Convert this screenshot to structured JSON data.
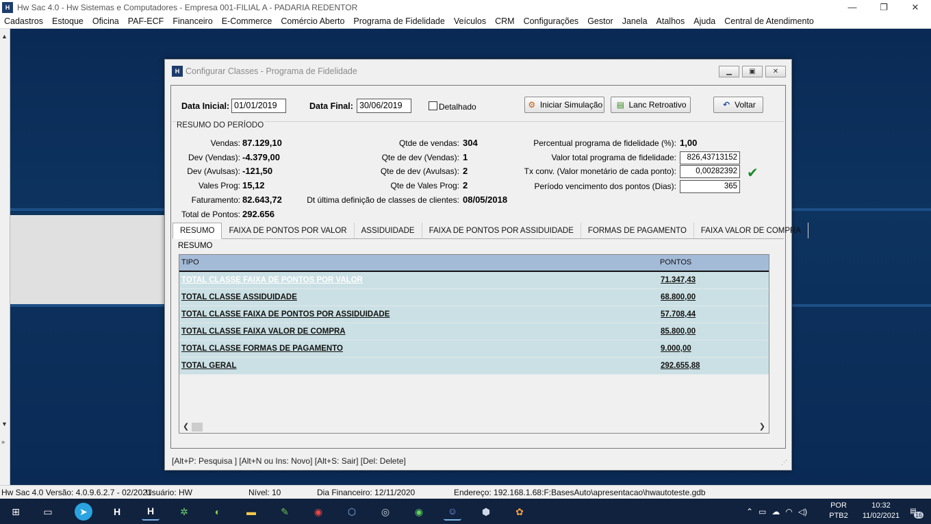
{
  "app": {
    "logo": "H",
    "title": "Hw Sac 4.0 - Hw Sistemas e Computadores - Empresa 001-FILIAL A - PADARIA REDENTOR",
    "minimize": "—",
    "restore": "❐",
    "close": "✕"
  },
  "menu": [
    "Cadastros",
    "Estoque",
    "Oficina",
    "PAF-ECF",
    "Financeiro",
    "E-Commerce",
    "Comércio Aberto",
    "Programa de Fidelidade",
    "Veículos",
    "CRM",
    "Configurações",
    "Gestor",
    "Janela",
    "Atalhos",
    "Ajuda",
    "Central de Atendimento"
  ],
  "dialog": {
    "title": "Configurar Classes - Programa de Fidelidade",
    "filters": {
      "data_inicial_label": "Data Inicial:",
      "data_inicial": "01/01/2019",
      "data_final_label": "Data Final:",
      "data_final": "30/06/2019",
      "detalhado_label": "Detalhado"
    },
    "buttons": {
      "simular": "Iniciar Simulação",
      "retroativo": "Lanc Retroativo",
      "voltar": "Voltar"
    },
    "resumo": {
      "title": "RESUMO DO PERÍODO",
      "col1": [
        {
          "label": "Vendas:",
          "value": "87.129,10"
        },
        {
          "label": "Dev (Vendas):",
          "value": "-4.379,00"
        },
        {
          "label": "Dev (Avulsas):",
          "value": "-121,50"
        },
        {
          "label": "Vales Prog:",
          "value": "15,12"
        },
        {
          "label": "Faturamento:",
          "value": "82.643,72"
        },
        {
          "label": "Total de Pontos:",
          "value": "292.656"
        }
      ],
      "col2": [
        {
          "label": "Qtde de vendas:",
          "value": "304"
        },
        {
          "label": "Qte de dev (Vendas):",
          "value": "1"
        },
        {
          "label": "Qte de dev (Avulsas):",
          "value": "2"
        },
        {
          "label": "Qte de Vales Prog:",
          "value": "2"
        },
        {
          "label": "Dt última definição de classes de clientes:",
          "value": "08/05/2018"
        }
      ],
      "col3": {
        "percentual_label": "Percentual programa de fidelidade (%):",
        "percentual": "1,00",
        "valor_total_label": "Valor total programa de fidelidade:",
        "valor_total": "826,43713152",
        "tx_conv_label": "Tx conv. (Valor monetário de cada ponto):",
        "tx_conv": "0,00282392",
        "periodo_label": "Período vencimento dos pontos (Dias):",
        "periodo": "365"
      }
    },
    "tabs": [
      "RESUMO",
      "FAIXA DE PONTOS POR VALOR",
      "ASSIDUIDADE",
      "FAIXA DE PONTOS POR ASSIDUIDADE",
      "FORMAS DE PAGAMENTO",
      "FAIXA VALOR DE COMPRA"
    ],
    "panel": {
      "title": "RESUMO",
      "columns": {
        "tipo": "TIPO",
        "pontos": "PONTOS"
      },
      "rows": [
        {
          "tipo": "TOTAL CLASSE FAIXA DE PONTOS POR VALOR",
          "pontos": "71.347,43"
        },
        {
          "tipo": "TOTAL CLASSE ASSIDUIDADE",
          "pontos": "68.800,00"
        },
        {
          "tipo": "TOTAL CLASSE FAIXA DE PONTOS POR ASSIDUIDADE",
          "pontos": "57.708,44"
        },
        {
          "tipo": "TOTAL CLASSE FAIXA VALOR DE COMPRA",
          "pontos": "85.800,00"
        },
        {
          "tipo": "TOTAL CLASSE FORMAS DE PAGAMENTO",
          "pontos": "9.000,00"
        },
        {
          "tipo": "TOTAL GERAL",
          "pontos": "292.655,88"
        }
      ]
    },
    "hotkeys": "[Alt+P: Pesquisa ]   [Alt+N ou Ins: Novo]   [Alt+S: Sair]   [Del: Delete]"
  },
  "status": {
    "versao": "Hw Sac 4.0 Versão: 4.0.9.6.2.7 - 02/2021",
    "usuario": "Usuário: HW",
    "nivel": "Nível: 10",
    "dia": "Dia Financeiro: 12/11/2020",
    "endereco": "Endereço: 192.168.1.68:F:BasesAuto\\apresentacao\\hwautoteste.gdb"
  },
  "taskbar": {
    "lang": "POR",
    "layout": "PTB2",
    "time": "10:32",
    "date": "11/02/2021",
    "notif": "16"
  },
  "colors": {
    "workspace": "#0a2a55",
    "grid_header": "#a4bbd8",
    "grid_row": "#cbe0e4",
    "taskbar": "#10223e",
    "check": "#1a8a2a"
  }
}
